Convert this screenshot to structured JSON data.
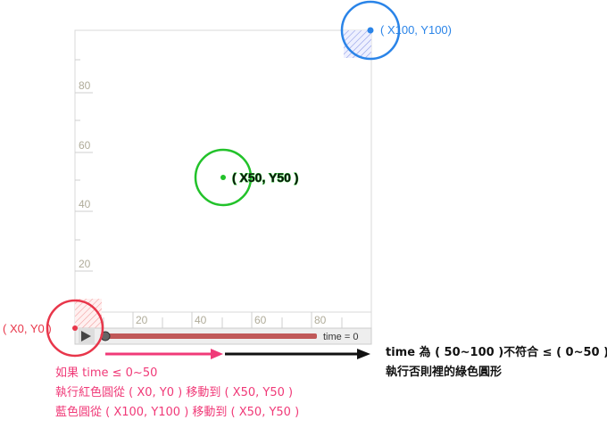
{
  "colors": {
    "red": "#e8364a",
    "pink": "#f03a78",
    "green": "#22c22a",
    "blue": "#2a84e8",
    "axis_text": "#b0ac9a",
    "grid": "#dddddd",
    "player_bar": "#c05858",
    "black": "#111111"
  },
  "chart": {
    "y_ticks": [
      "20",
      "40",
      "60",
      "80"
    ],
    "x_ticks": [
      "20",
      "40",
      "60",
      "80"
    ]
  },
  "player": {
    "play_icon": "play-icon",
    "time_label": "time = 0",
    "progress": 0
  },
  "points": {
    "origin_label": "( X0, Y0 )",
    "middle_label": "( X50, Y50 )",
    "end_label": "( X100, Y100)"
  },
  "notes": {
    "condition_line1": "如果 time ≤ 0~50",
    "condition_line2": "執行紅色圓從 ( X0, Y0 ) 移動到 ( X50, Y50 )",
    "condition_line3": "藍色圓從 ( X100, Y100 ) 移動到 ( X50, Y50 )",
    "else_line1": "time 為 ( 50~100 )不符合 ≤ ( 0~50 )",
    "else_line2": "執行否則裡的綠色圓形"
  }
}
